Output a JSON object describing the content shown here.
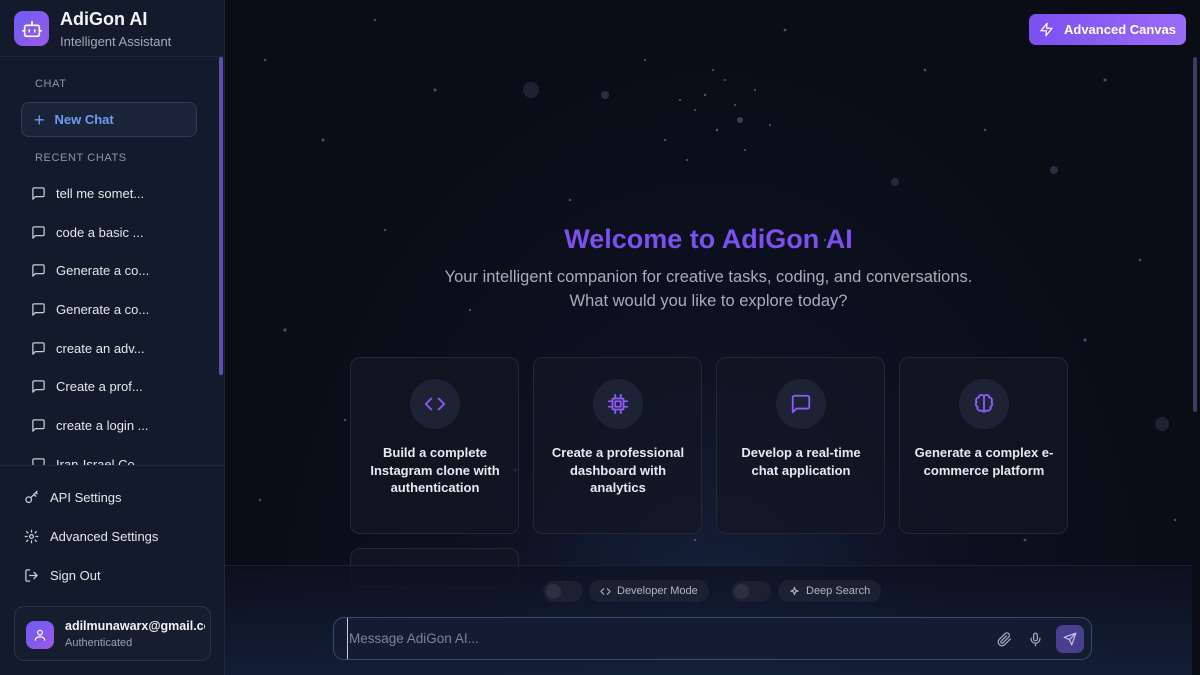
{
  "brand": {
    "title": "AdiGon AI",
    "subtitle": "Intelligent Assistant",
    "icon": "robot-icon"
  },
  "sidebar": {
    "chat_section": "CHAT",
    "new_chat_label": "New Chat",
    "recent_section": "RECENT CHATS",
    "recent_chats": [
      {
        "label": "tell me somet..."
      },
      {
        "label": "code a basic ..."
      },
      {
        "label": "Generate a co..."
      },
      {
        "label": "Generate a co..."
      },
      {
        "label": "create an adv..."
      },
      {
        "label": "Create a prof..."
      },
      {
        "label": "create a login ..."
      },
      {
        "label": "Iran-Israel Co..."
      }
    ],
    "footer": {
      "api_settings": "API Settings",
      "advanced_settings": "Advanced Settings",
      "sign_out": "Sign Out"
    },
    "user": {
      "email": "adilmunawarx@gmail.com",
      "status": "Authenticated"
    }
  },
  "header": {
    "advanced_canvas_label": "Advanced Canvas"
  },
  "hero": {
    "title": "Welcome to AdiGon AI",
    "tagline_line1": "Your intelligent companion for creative tasks, coding, and conversations.",
    "tagline_line2": "What would you like to explore today?"
  },
  "suggestions": [
    {
      "icon": "code-icon",
      "text": "Build a complete Instagram clone with authentication"
    },
    {
      "icon": "cpu-chip-icon",
      "text": "Create a professional dashboard with analytics"
    },
    {
      "icon": "message-square-icon",
      "text": "Develop a real-time chat application"
    },
    {
      "icon": "brain-icon",
      "text": "Generate a complex e-commerce platform"
    }
  ],
  "modes": {
    "developer_mode": "Developer Mode",
    "deep_search": "Deep Search",
    "developer_mode_on": false,
    "deep_search_on": false
  },
  "composer": {
    "placeholder": "Message AdiGon AI..."
  },
  "colors": {
    "accent": "#7c4ff0",
    "sidebar_bg": "#131a2b",
    "main_bg": "#0b0d19",
    "link": "#6d9cf5"
  }
}
